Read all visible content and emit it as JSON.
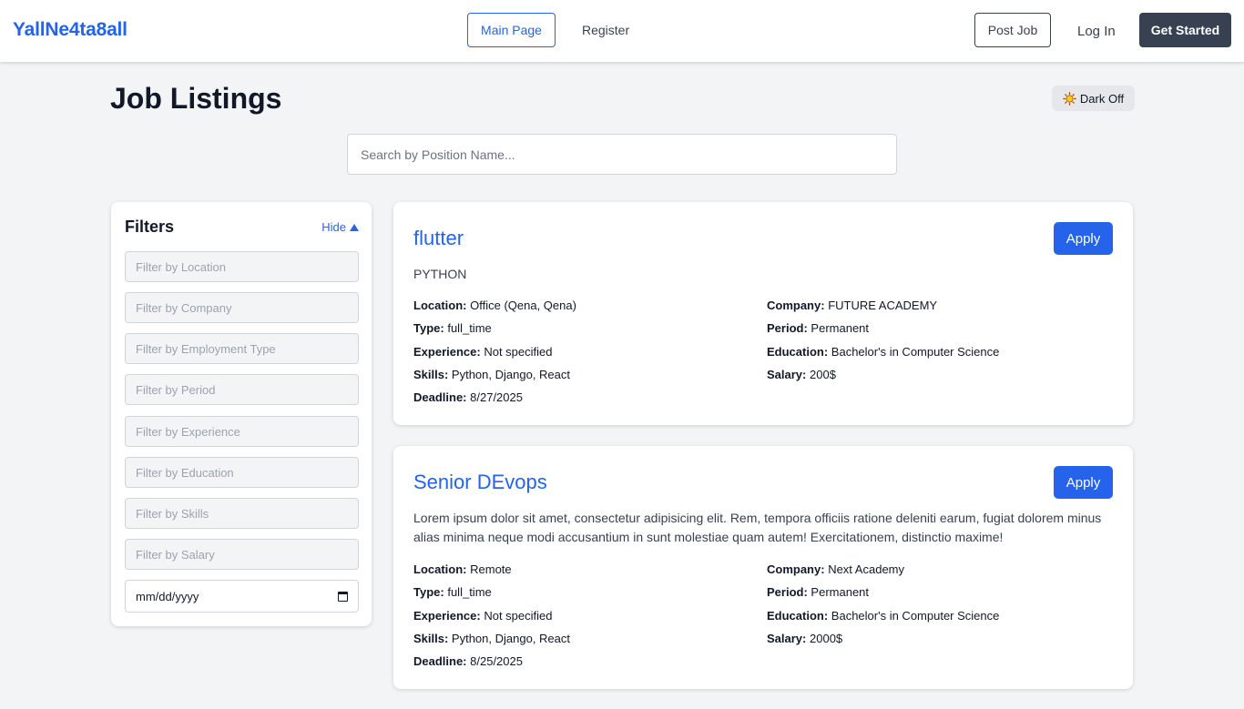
{
  "nav": {
    "brand": "YallNe4ta8all",
    "main_page": "Main Page",
    "register": "Register",
    "post_job": "Post Job",
    "log_in": "Log In",
    "get_started": "Get Started"
  },
  "page": {
    "title": "Job Listings",
    "dark_toggle": "Dark Off",
    "search_placeholder": "Search by Position Name..."
  },
  "filters": {
    "title": "Filters",
    "hide_label": "Hide",
    "location": "Filter by Location",
    "company": "Filter by Company",
    "employment_type": "Filter by Employment Type",
    "period": "Filter by Period",
    "experience": "Filter by Experience",
    "education": "Filter by Education",
    "skills": "Filter by Skills",
    "salary": "Filter by Salary",
    "date": "mm/dd/yyyy"
  },
  "labels": {
    "location": "Location:",
    "company": "Company:",
    "type": "Type:",
    "period": "Period:",
    "experience": "Experience:",
    "education": "Education:",
    "skills": "Skills:",
    "salary": "Salary:",
    "deadline": "Deadline:",
    "apply": "Apply"
  },
  "jobs": [
    {
      "title": "flutter",
      "description": "PYTHON",
      "location": "Office (Qena, Qena)",
      "company": "FUTURE ACADEMY",
      "type": "full_time",
      "period": "Permanent",
      "experience": "Not specified",
      "education": "Bachelor's in Computer Science",
      "skills": "Python, Django, React",
      "salary": "200$",
      "deadline": "8/27/2025"
    },
    {
      "title": "Senior DEvops",
      "description": "Lorem ipsum dolor sit amet, consectetur adipisicing elit. Rem, tempora officiis ratione deleniti earum, fugiat dolorem minus alias minima neque modi accusantium in sunt molestiae quam autem! Exercitationem, distinctio maxime!",
      "location": "Remote",
      "company": "Next Academy",
      "type": "full_time",
      "period": "Permanent",
      "experience": "Not specified",
      "education": "Bachelor's in Computer Science",
      "skills": "Python, Django, React",
      "salary": "2000$",
      "deadline": "8/25/2025"
    }
  ]
}
